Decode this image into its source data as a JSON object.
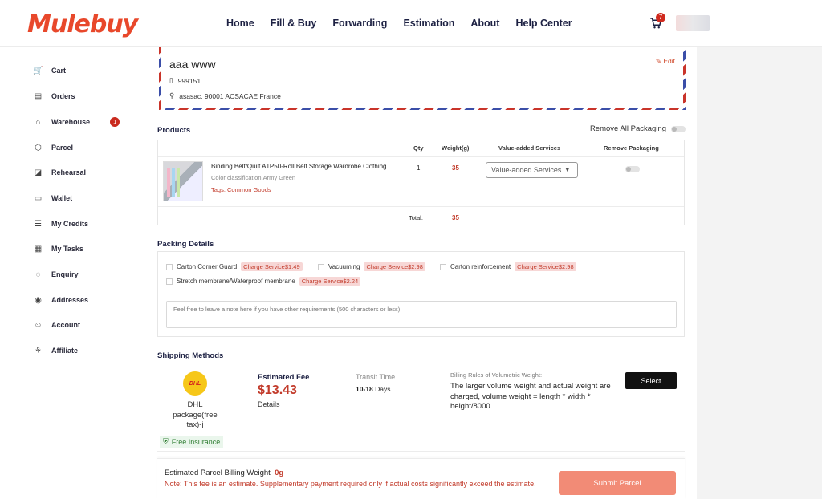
{
  "header": {
    "logo": "Mulebuy",
    "nav": [
      "Home",
      "Fill & Buy",
      "Forwarding",
      "Estimation",
      "About",
      "Help Center"
    ],
    "cart_count": "7"
  },
  "sidebar": {
    "items": [
      {
        "label": "Cart",
        "icon": "cart-icon"
      },
      {
        "label": "Orders",
        "icon": "orders-icon"
      },
      {
        "label": "Warehouse",
        "icon": "warehouse-icon",
        "badge": "1"
      },
      {
        "label": "Parcel",
        "icon": "parcel-icon"
      },
      {
        "label": "Rehearsal",
        "icon": "rehearsal-icon"
      },
      {
        "label": "Wallet",
        "icon": "wallet-icon"
      },
      {
        "label": "My Credits",
        "icon": "credits-icon"
      },
      {
        "label": "My Tasks",
        "icon": "tasks-icon"
      },
      {
        "label": "Enquiry",
        "icon": "enquiry-icon"
      },
      {
        "label": "Addresses",
        "icon": "location-icon"
      },
      {
        "label": "Account",
        "icon": "account-icon"
      },
      {
        "label": "Affiliate",
        "icon": "affiliate-icon"
      }
    ]
  },
  "address": {
    "name": "aaa www",
    "phone": "999151",
    "location": "asasac, 90001 ACSACAE France",
    "edit": "Edit"
  },
  "products": {
    "title": "Products",
    "remove_all": "Remove All Packaging",
    "headers": {
      "qty": "Qty",
      "weight": "Weight(g)",
      "vas": "Value-added Services",
      "remove": "Remove Packaging"
    },
    "item": {
      "name": "Binding Belt/Quilt A1P50-Roll Belt Storage Wardrobe Clothing...",
      "color": "Color classification:Army Green",
      "tags": "Tags: Common Goods",
      "qty": "1",
      "weight": "35",
      "vas_placeholder": "Value-added Services"
    },
    "total_label": "Total:",
    "total_value": "35"
  },
  "packing": {
    "title": "Packing Details",
    "options": [
      {
        "label": "Carton Corner Guard",
        "charge": "Charge Service$1.49"
      },
      {
        "label": "Vacuuming",
        "charge": "Charge Service$2.98"
      },
      {
        "label": "Carton reinforcement",
        "charge": "Charge Service$2.98"
      },
      {
        "label": "Stretch membrane/Waterproof membrane",
        "charge": "Charge Service$2.24"
      }
    ],
    "note_placeholder": "Feel free to leave a note here if you have other requirements (500 characters or less)"
  },
  "shipping": {
    "title": "Shipping Methods",
    "carrier_logo": "DHL",
    "carrier_name": "DHL package(free tax)-j",
    "free_insurance": "Free Insurance",
    "est_label": "Estimated Fee",
    "est_price": "$13.43",
    "details": "Details",
    "transit_label": "Transit Time",
    "transit_days": "10-18",
    "transit_unit": " Days",
    "billing_label": "Billing Rules of Volumetric Weight:",
    "billing_text": "The larger volume weight and actual weight are charged, volume weight = length * width * height/8000",
    "select": "Select"
  },
  "footer": {
    "weight_label": "Estimated Parcel Billing Weight",
    "weight_value": "0g",
    "note": "Note: This fee is an estimate. Supplementary payment required only if actual costs significantly exceed the estimate.",
    "submit": "Submit Parcel"
  },
  "colors": {
    "accent": "#e8482b",
    "price": "#c23b2b",
    "submit": "#f28b76"
  }
}
